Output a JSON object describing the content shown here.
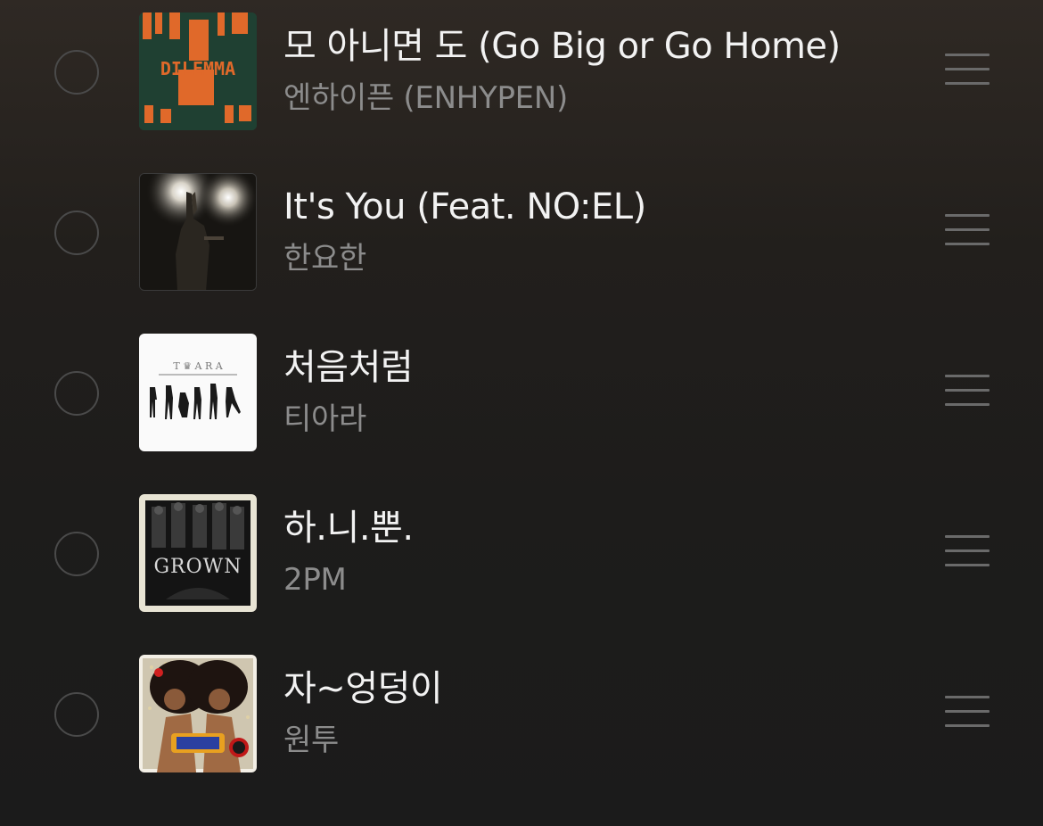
{
  "tracks": [
    {
      "title": "모 아니면 도 (Go Big or Go Home)",
      "artist": "엔하이픈 (ENHYPEN)",
      "cover_icon": "album-cover-dilemma",
      "cover_text": "DILEMMA"
    },
    {
      "title": "It's You (Feat. NO:EL)",
      "artist": "한요한",
      "cover_icon": "album-cover-concert-photo"
    },
    {
      "title": "처음처럼",
      "artist": "티아라",
      "cover_icon": "album-cover-tara",
      "cover_text": "T ♛ A R A"
    },
    {
      "title": "하.니.뿐.",
      "artist": "2PM",
      "cover_icon": "album-cover-grown",
      "cover_text": "GROWN"
    },
    {
      "title": "자~엉덩이",
      "artist": "원투",
      "cover_icon": "album-cover-afro-photo"
    }
  ],
  "colors": {
    "title": "#f2f2f2",
    "artist": "#8c8c8c",
    "control": "#4a4a4a",
    "handle": "#6a6a6a"
  }
}
